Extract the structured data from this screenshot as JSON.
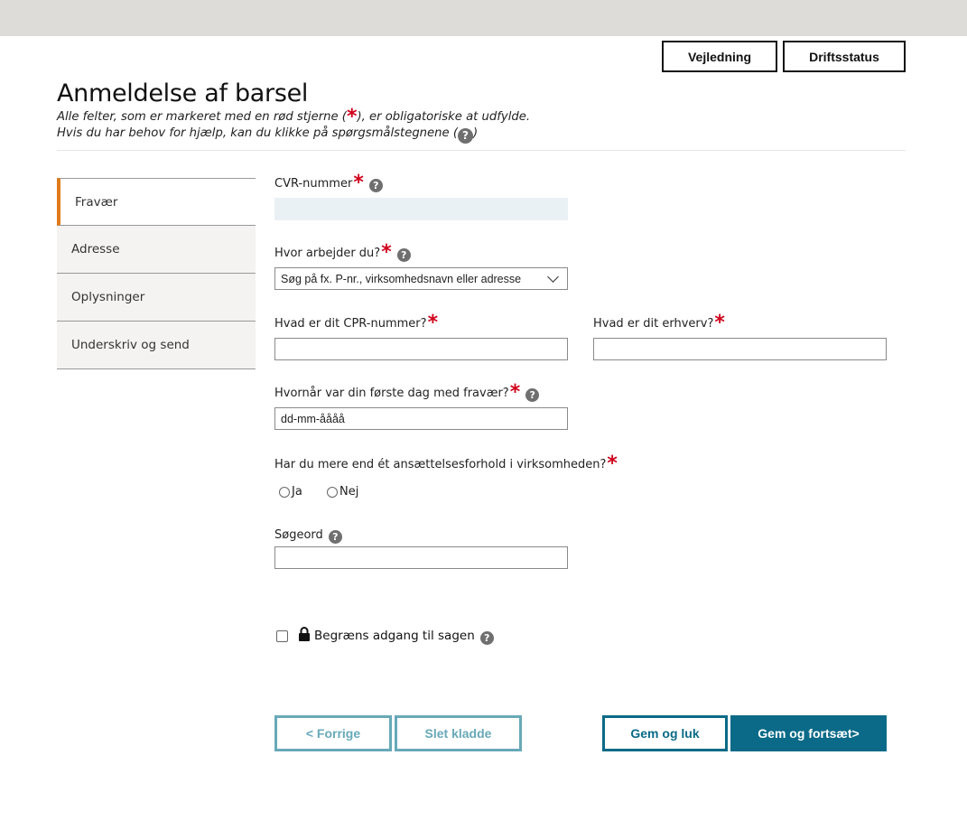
{
  "header": {
    "guide_button": "Vejledning",
    "status_button": "Driftsstatus"
  },
  "page": {
    "title": "Anmeldelse af barsel",
    "intro_line1_before": "Alle felter, som er markeret med en rød stjerne (",
    "intro_star": "*",
    "intro_line1_after": "), er obligatoriske at udfylde.",
    "intro_line2_before": "Hvis du har behov for hjælp, kan du klikke på spørgsmålstegnene (",
    "intro_line2_after": ")"
  },
  "sidebar": {
    "items": [
      {
        "label": "Fravær",
        "active": true
      },
      {
        "label": "Adresse",
        "active": false
      },
      {
        "label": "Oplysninger",
        "active": false
      },
      {
        "label": "Underskriv og send",
        "active": false
      }
    ]
  },
  "form": {
    "required_marker": "*",
    "help_glyph": "?",
    "cvr": {
      "label": "CVR-nummer",
      "value": ""
    },
    "workplace": {
      "label": "Hvor arbejder du?",
      "value": "Søg på fx. P-nr., virksomhedsnavn eller adresse"
    },
    "cpr": {
      "label": "Hvad er dit CPR-nummer?",
      "value": ""
    },
    "occupation": {
      "label": "Hvad er dit erhverv?",
      "value": ""
    },
    "first_day": {
      "label": "Hvornår var din første dag med fravær?",
      "value": "dd-mm-åååå"
    },
    "multiple_employment": {
      "label": "Har du mere end ét ansættelsesforhold i virksomheden?",
      "options": [
        "Ja",
        "Nej"
      ]
    },
    "keyword": {
      "label": "Søgeord",
      "value": ""
    },
    "restrict_access": {
      "label": "Begræns adgang til sagen",
      "checked": false
    }
  },
  "actions": {
    "previous": "< Forrige",
    "delete_draft": "Slet kladde",
    "save_close": "Gem og luk",
    "save_continue": "Gem og fortsæt>"
  },
  "colors": {
    "accent_orange": "#e07b1b",
    "primary_teal": "#0a6a87",
    "light_teal": "#68a9b8",
    "required_red": "#d0021b"
  }
}
